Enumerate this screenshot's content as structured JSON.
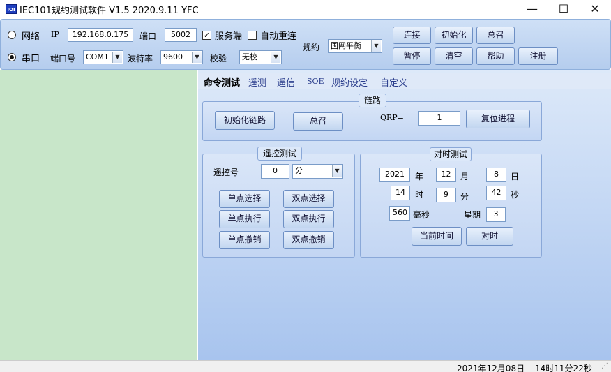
{
  "window": {
    "icon_text": "IOI",
    "title": "IEC101规约测试软件  V1.5 2020.9.11   YFC",
    "minimize": "—",
    "maximize": "☐",
    "close": "✕"
  },
  "toolbar": {
    "network_label": "网络",
    "ip_label": "IP",
    "ip_value": "192.168.0.175",
    "port_label": "端口",
    "port_value": "5002",
    "server_label": "服务端",
    "server_checked": true,
    "reconnect_label": "自动重连",
    "reconnect_checked": false,
    "serial_label": "串口",
    "serial_selected": true,
    "portno_label": "端口号",
    "portno_value": "COM1",
    "baud_label": "波特率",
    "baud_value": "9600",
    "check_label": "校验",
    "check_value": "无校",
    "protocol_label": "规约",
    "protocol_value": "国网平衡",
    "connect": "连接",
    "init": "初始化",
    "general_call": "总召",
    "pause": "暂停",
    "clear": "清空",
    "help": "帮助",
    "register": "注册"
  },
  "tabs": [
    "命令测试",
    "遥测",
    "遥信",
    "SOE",
    "规约设定",
    "自定义"
  ],
  "link_group": {
    "title": "链路",
    "init_link": "初始化链路",
    "general_call": "总召",
    "qrp_label": "QRP=",
    "qrp_value": "1",
    "reset_process": "复位进程"
  },
  "remote_control": {
    "title": "遥控测试",
    "number_label": "遥控号",
    "number_value": "0",
    "mode_value": "分",
    "single_select": "单点选择",
    "double_select": "双点选择",
    "single_execute": "单点执行",
    "double_execute": "双点执行",
    "single_cancel": "单点撤销",
    "double_cancel": "双点撤销"
  },
  "time_sync": {
    "title": "对时测试",
    "year_value": "2021",
    "year_label": "年",
    "month_value": "12",
    "month_label": "月",
    "day_value": "8",
    "day_label": "日",
    "hour_value": "14",
    "hour_label": "时",
    "minute_value": "9",
    "minute_label": "分",
    "second_value": "42",
    "second_label": "秒",
    "ms_value": "560",
    "ms_label": "毫秒",
    "weekday_label": "星期",
    "weekday_value": "3",
    "current_time": "当前时间",
    "sync": "对时"
  },
  "status": {
    "date": "2021年12月08日",
    "time": "14时11分22秒"
  }
}
